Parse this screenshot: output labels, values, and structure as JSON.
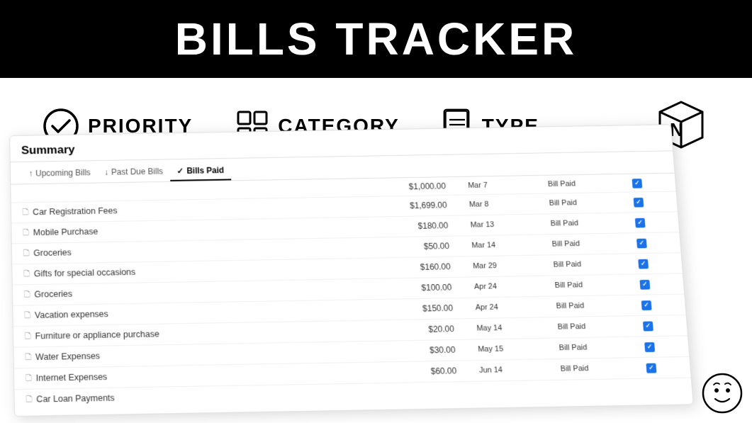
{
  "header": {
    "title": "BILLS TRACKER"
  },
  "icons": [
    {
      "name": "priority",
      "label": "PRIORITY"
    },
    {
      "name": "category",
      "label": "CATEGORY"
    },
    {
      "name": "type",
      "label": "TYPE"
    }
  ],
  "summary": {
    "title": "Summary",
    "tabs": [
      {
        "label": "Upcoming Bills",
        "icon": "↑",
        "active": false
      },
      {
        "label": "Past Due Bills",
        "icon": "↓",
        "active": false
      },
      {
        "label": "Bills Paid",
        "icon": "✓",
        "active": true
      }
    ],
    "bills": [
      {
        "name": "",
        "amount": "$1,000.00",
        "date": "Mar 7",
        "status": "Bill Paid",
        "checked": true
      },
      {
        "name": "Car Registration Fees",
        "amount": "$1,699.00",
        "date": "Mar 8",
        "status": "Bill Paid",
        "checked": true
      },
      {
        "name": "Mobile Purchase",
        "amount": "$180.00",
        "date": "Mar 13",
        "status": "Bill Paid",
        "checked": true
      },
      {
        "name": "Groceries",
        "amount": "$50.00",
        "date": "Mar 14",
        "status": "Bill Paid",
        "checked": true
      },
      {
        "name": "Gifts for special occasions",
        "amount": "$160.00",
        "date": "Mar 29",
        "status": "Bill Paid",
        "checked": true
      },
      {
        "name": "Groceries",
        "amount": "$100.00",
        "date": "Apr 24",
        "status": "Bill Paid",
        "checked": true
      },
      {
        "name": "Vacation expenses",
        "amount": "$150.00",
        "date": "Apr 24",
        "status": "Bill Paid",
        "checked": true
      },
      {
        "name": "Furniture or appliance purchase",
        "amount": "$20.00",
        "date": "May 14",
        "status": "Bill Paid",
        "checked": true
      },
      {
        "name": "Water Expenses",
        "amount": "$30.00",
        "date": "May 15",
        "status": "Bill Paid",
        "checked": true
      },
      {
        "name": "Internet Expenses",
        "amount": "$60.00",
        "date": "Jun 14",
        "status": "Bill Paid",
        "checked": true
      },
      {
        "name": "Car Loan Payments",
        "amount": "",
        "date": "",
        "status": "",
        "checked": false
      }
    ]
  }
}
